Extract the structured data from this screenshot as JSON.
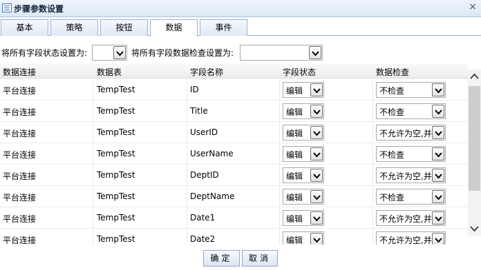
{
  "window": {
    "title": "步骤参数设置",
    "close_symbol": "×"
  },
  "tabs": [
    "基本",
    "策略",
    "按钮",
    "数据",
    "事件"
  ],
  "active_tab": "数据",
  "setters": {
    "status_label": "将所有字段状态设置为:",
    "status_value": "",
    "check_label": "将所有字段数据检查设置为:",
    "check_value": ""
  },
  "grid": {
    "columns": [
      "数据连接",
      "数据表",
      "字段名称",
      "字段状态",
      "数据检查"
    ],
    "rows": [
      {
        "connection": "平台连接",
        "table": "TempTest",
        "field": "ID",
        "status": "编辑",
        "check": "不检查"
      },
      {
        "connection": "平台连接",
        "table": "TempTest",
        "field": "Title",
        "status": "编辑",
        "check": "不检查"
      },
      {
        "connection": "平台连接",
        "table": "TempTest",
        "field": "UserID",
        "status": "编辑",
        "check": "不允许为空,并"
      },
      {
        "connection": "平台连接",
        "table": "TempTest",
        "field": "UserName",
        "status": "编辑",
        "check": "不检查"
      },
      {
        "connection": "平台连接",
        "table": "TempTest",
        "field": "DeptID",
        "status": "编辑",
        "check": "不允许为空,并"
      },
      {
        "connection": "平台连接",
        "table": "TempTest",
        "field": "DeptName",
        "status": "编辑",
        "check": "不检查"
      },
      {
        "connection": "平台连接",
        "table": "TempTest",
        "field": "Date1",
        "status": "编辑",
        "check": "不允许为空,并"
      },
      {
        "connection": "平台连接",
        "table": "TempTest",
        "field": "Date2",
        "status": "编辑",
        "check": "不允许为空,并"
      }
    ]
  },
  "buttons": {
    "ok": "确定",
    "cancel": "取消"
  }
}
